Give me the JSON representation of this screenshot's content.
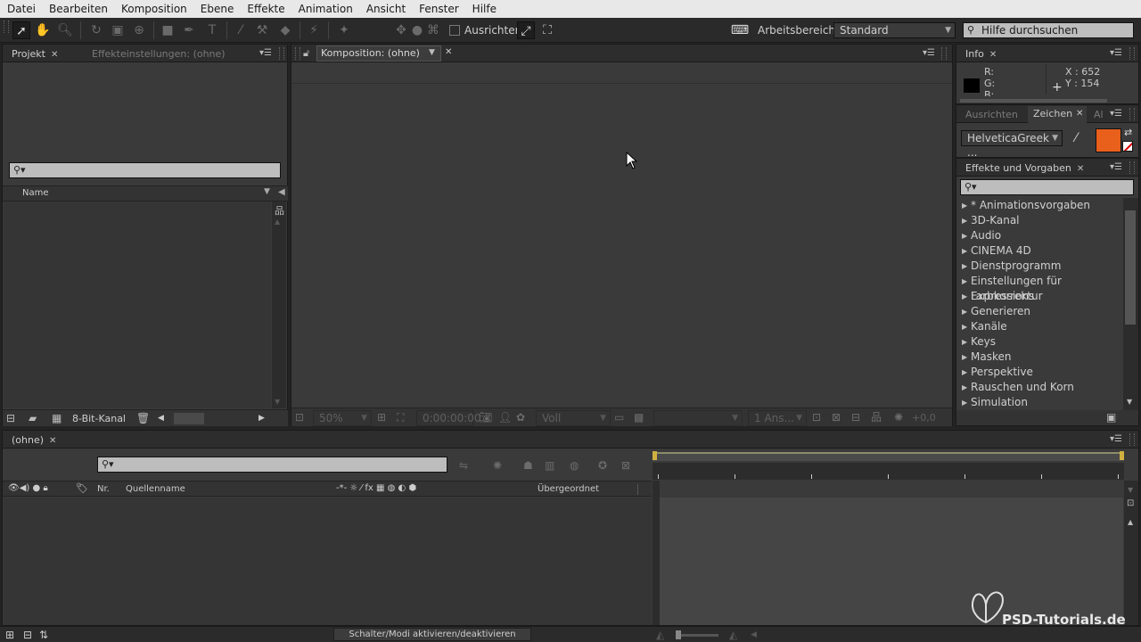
{
  "menu": [
    "Datei",
    "Bearbeiten",
    "Komposition",
    "Ebene",
    "Effekte",
    "Animation",
    "Ansicht",
    "Fenster",
    "Hilfe"
  ],
  "toolbar": {
    "align_label": "Ausrichten",
    "workspace_label": "Arbeitsbereich:",
    "workspace_value": "Standard",
    "help_placeholder": "Hilfe durchsuchen"
  },
  "project_panel": {
    "tab_project": "Projekt",
    "tab_effects_settings": "Effekteinstellungen: (ohne)",
    "column_name": "Name",
    "bit_depth": "8-Bit-Kanal"
  },
  "composition_panel": {
    "tab_label": "Komposition: (ohne)",
    "zoom": "50%",
    "timecode": "0:00:00:00",
    "resolution": "Voll",
    "views": "1 Ans...",
    "exposure": "+0,0"
  },
  "info_panel": {
    "tab": "Info",
    "r_label": "R:",
    "g_label": "G:",
    "b_label": "B:",
    "x_label": "X : 652",
    "y_label": "Y : 154"
  },
  "character_panel": {
    "tab_align": "Ausrichten",
    "tab_character": "Zeichen",
    "tab_al": "Al",
    "font": "HelveticaGreek ...",
    "fill_color": "#e8601c"
  },
  "effects_panel": {
    "tab": "Effekte und Vorgaben",
    "items": [
      "* Animationsvorgaben",
      "3D-Kanal",
      "Audio",
      "CINEMA 4D",
      "Dienstprogramm",
      "Einstellungen für Expressions",
      "Farbkorrektur",
      "Generieren",
      "Kanäle",
      "Keys",
      "Masken",
      "Perspektive",
      "Rauschen und Korn",
      "Simulation"
    ]
  },
  "timeline": {
    "tab": "(ohne)",
    "col_nr": "Nr.",
    "col_source": "Quellenname",
    "col_parent": "Übergeordnet",
    "toggle_modes": "Schalter/Modi aktivieren/deaktivieren"
  },
  "watermark": "PSD-Tutorials.de",
  "colors": {
    "accent_orange": "#e8601c",
    "work_area_yellow": "#d0b040"
  }
}
